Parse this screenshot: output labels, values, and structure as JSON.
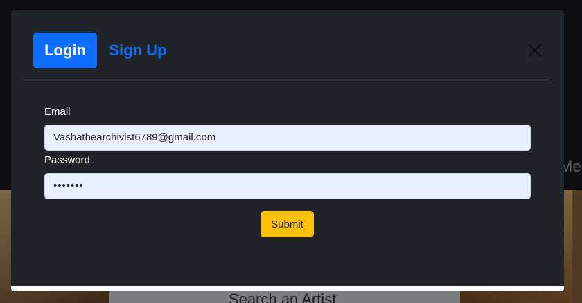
{
  "background": {
    "nav_fragment": "Me",
    "hero_title": "Search an Artist"
  },
  "modal": {
    "tabs": [
      {
        "label": "Login",
        "active": true
      },
      {
        "label": "Sign Up",
        "active": false
      }
    ],
    "close_icon": "close-icon",
    "form": {
      "email_label": "Email",
      "email_value": "Vashathearchivist6789@gmail.com",
      "password_label": "Password",
      "password_value": "•••••••",
      "submit_label": "Submit"
    }
  },
  "colors": {
    "modal_bg": "#212429",
    "primary": "#0d6efd",
    "warning": "#ffc107",
    "input_autofill_bg": "#e8f0fe"
  }
}
